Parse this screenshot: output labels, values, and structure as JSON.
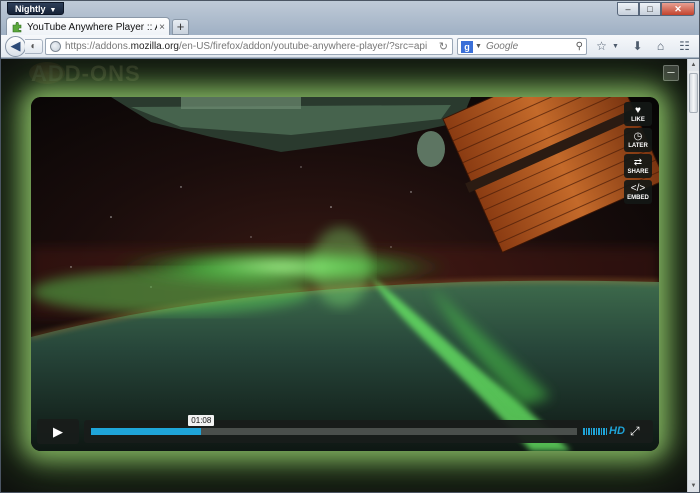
{
  "browser": {
    "app_menu_label": "Nightly",
    "tab": {
      "title": "YouTube Anywhere Player :: Add-ons fo...",
      "close": "×"
    },
    "new_tab": "+",
    "url": {
      "prefix": "https://addons.",
      "host": "mozilla.org",
      "path": "/en-US/firefox/addon/youtube-anywhere-player/?src=api"
    },
    "search": {
      "engine": "g",
      "placeholder": "Google"
    },
    "window_buttons": {
      "minimize": "–",
      "maximize": "□",
      "close": "✕"
    }
  },
  "page": {
    "background_header": "ADD-ONS",
    "minimize_player": "–"
  },
  "player": {
    "side_actions": [
      {
        "icon": "♥",
        "label": "LIKE"
      },
      {
        "icon": "◷",
        "label": "LATER"
      },
      {
        "icon": "⇄",
        "label": "SHARE"
      },
      {
        "icon": "</>",
        "label": "EMBED"
      }
    ],
    "play_icon": "▶",
    "current_time": "01:08",
    "progress": 0.227,
    "hd_label": "HD",
    "fullscreen_icon": "⤢",
    "accent_color": "#1fa4d8"
  }
}
